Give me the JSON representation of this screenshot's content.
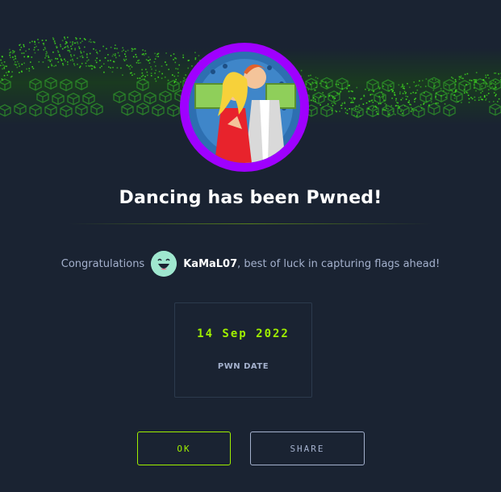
{
  "dialog": {
    "title": "Dancing has been Pwned!",
    "congrats_prefix": "Congratulations",
    "username": "KaMaL07",
    "congrats_suffix": ", best of luck in capturing flags ahead!",
    "pwn_date": "14 Sep 2022",
    "pwn_date_label": "PWN DATE",
    "ok_label": "OK",
    "share_label": "SHARE"
  },
  "icons": {
    "machine_avatar": "dancing-couple-avatar",
    "user_avatar": "smiling-face-avatar",
    "banner": "green-wave-cube-banner"
  },
  "colors": {
    "background": "#1a2332",
    "accent": "#9fef00",
    "avatar_ring": "#9f00ff",
    "muted_text": "#a4b1cd",
    "title_text": "#ffffff"
  }
}
